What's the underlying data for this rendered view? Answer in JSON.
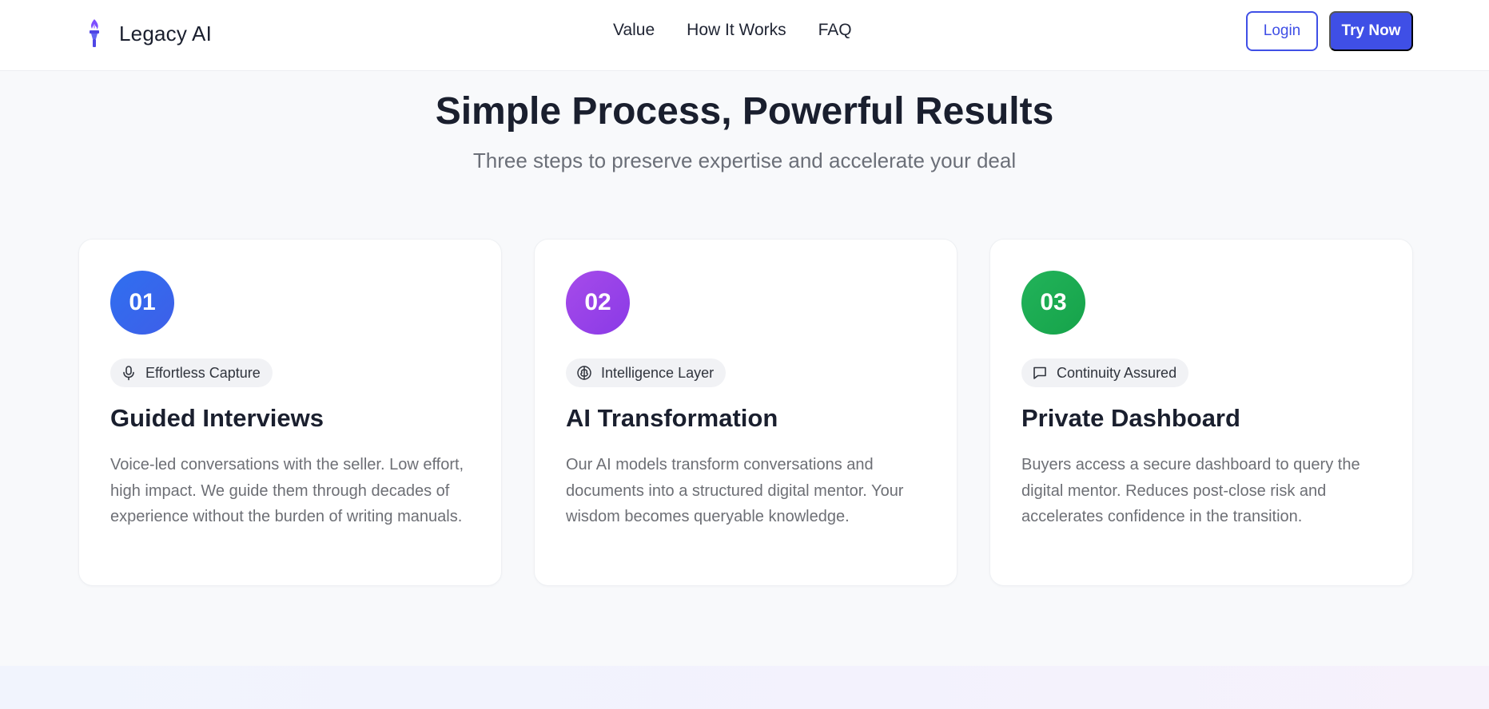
{
  "brand": {
    "name": "Legacy AI",
    "logo_icon": "torch-icon"
  },
  "nav": {
    "items": [
      "Value",
      "How It Works",
      "FAQ"
    ]
  },
  "actions": {
    "login_label": "Login",
    "try_label": "Try Now"
  },
  "colors": {
    "accent": "#3f4fe6",
    "step1": [
      "#2f6ff0",
      "#3e5fe8"
    ],
    "step2": [
      "#a64bea",
      "#8a3ae6"
    ],
    "step3": [
      "#22b35a",
      "#16a34a"
    ]
  },
  "section": {
    "title": "Simple Process, Powerful Results",
    "subtitle": "Three steps to preserve expertise and accelerate your deal"
  },
  "steps": [
    {
      "number": "01",
      "tag_icon": "microphone-icon",
      "tag": "Effortless Capture",
      "title": "Guided Interviews",
      "description": "Voice-led conversations with the seller. Low effort, high impact. We guide them through decades of experience without the burden of writing manuals."
    },
    {
      "number": "02",
      "tag_icon": "brain-icon",
      "tag": "Intelligence Layer",
      "title": "AI Transformation",
      "description": "Our AI models transform conversations and documents into a structured digital mentor. Your wisdom becomes queryable knowledge."
    },
    {
      "number": "03",
      "tag_icon": "chat-bubble-icon",
      "tag": "Continuity Assured",
      "title": "Private Dashboard",
      "description": "Buyers access a secure dashboard to query the digital mentor. Reduces post-close risk and accelerates confidence in the transition."
    }
  ]
}
